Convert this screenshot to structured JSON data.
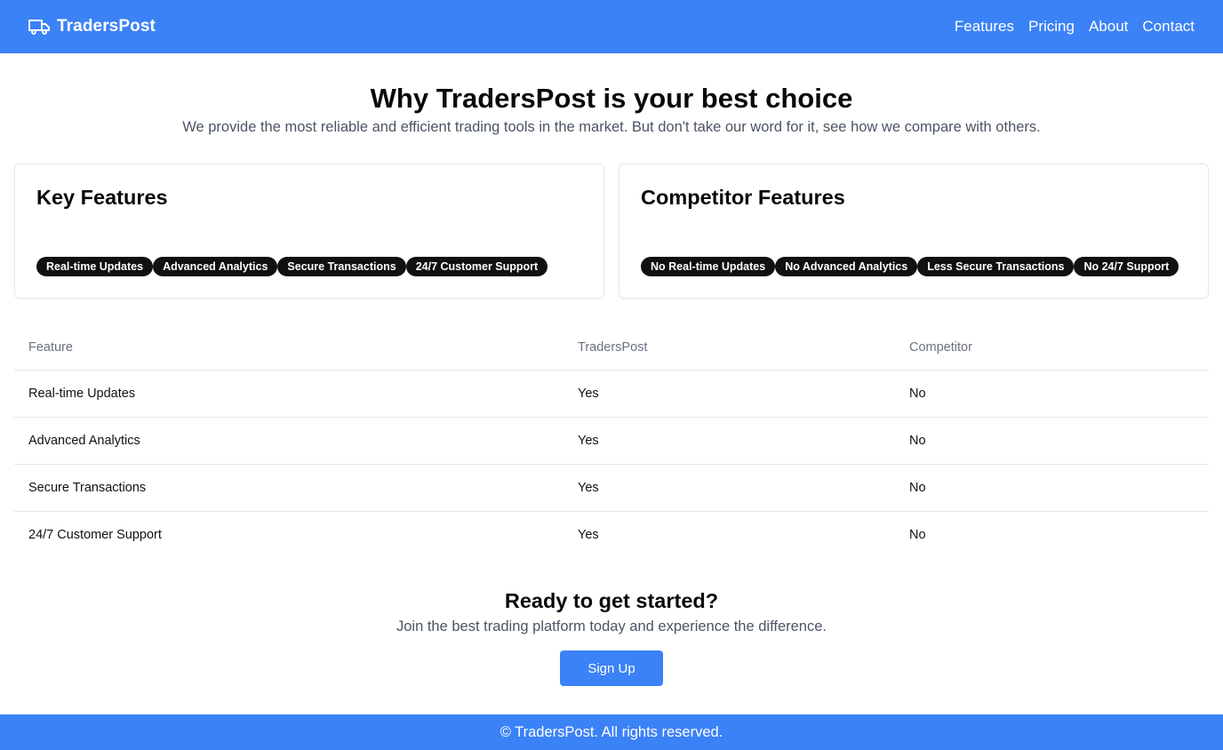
{
  "nav": {
    "brand": "TradersPost",
    "brand_icon": "truck-icon",
    "links": [
      "Features",
      "Pricing",
      "About",
      "Contact"
    ]
  },
  "hero": {
    "title": "Why TradersPost is your best choice",
    "subtitle": "We provide the most reliable and efficient trading tools in the market. But don't take our word for it, see how we compare with others."
  },
  "cards": {
    "key": {
      "title": "Key Features",
      "badges": [
        "Real-time Updates",
        "Advanced Analytics",
        "Secure Transactions",
        "24/7 Customer Support"
      ]
    },
    "competitor": {
      "title": "Competitor Features",
      "badges": [
        "No Real-time Updates",
        "No Advanced Analytics",
        "Less Secure Transactions",
        "No 24/7 Support"
      ]
    }
  },
  "table": {
    "headers": [
      "Feature",
      "TradersPost",
      "Competitor"
    ],
    "rows": [
      [
        "Real-time Updates",
        "Yes",
        "No"
      ],
      [
        "Advanced Analytics",
        "Yes",
        "No"
      ],
      [
        "Secure Transactions",
        "Yes",
        "No"
      ],
      [
        "24/7 Customer Support",
        "Yes",
        "No"
      ]
    ]
  },
  "cta": {
    "title": "Ready to get started?",
    "subtitle": "Join the best trading platform today and experience the difference.",
    "button": "Sign Up"
  },
  "footer": {
    "text": "© TradersPost. All rights reserved."
  },
  "colors": {
    "primary": "#3b82f6",
    "badge_bg": "#111111"
  }
}
